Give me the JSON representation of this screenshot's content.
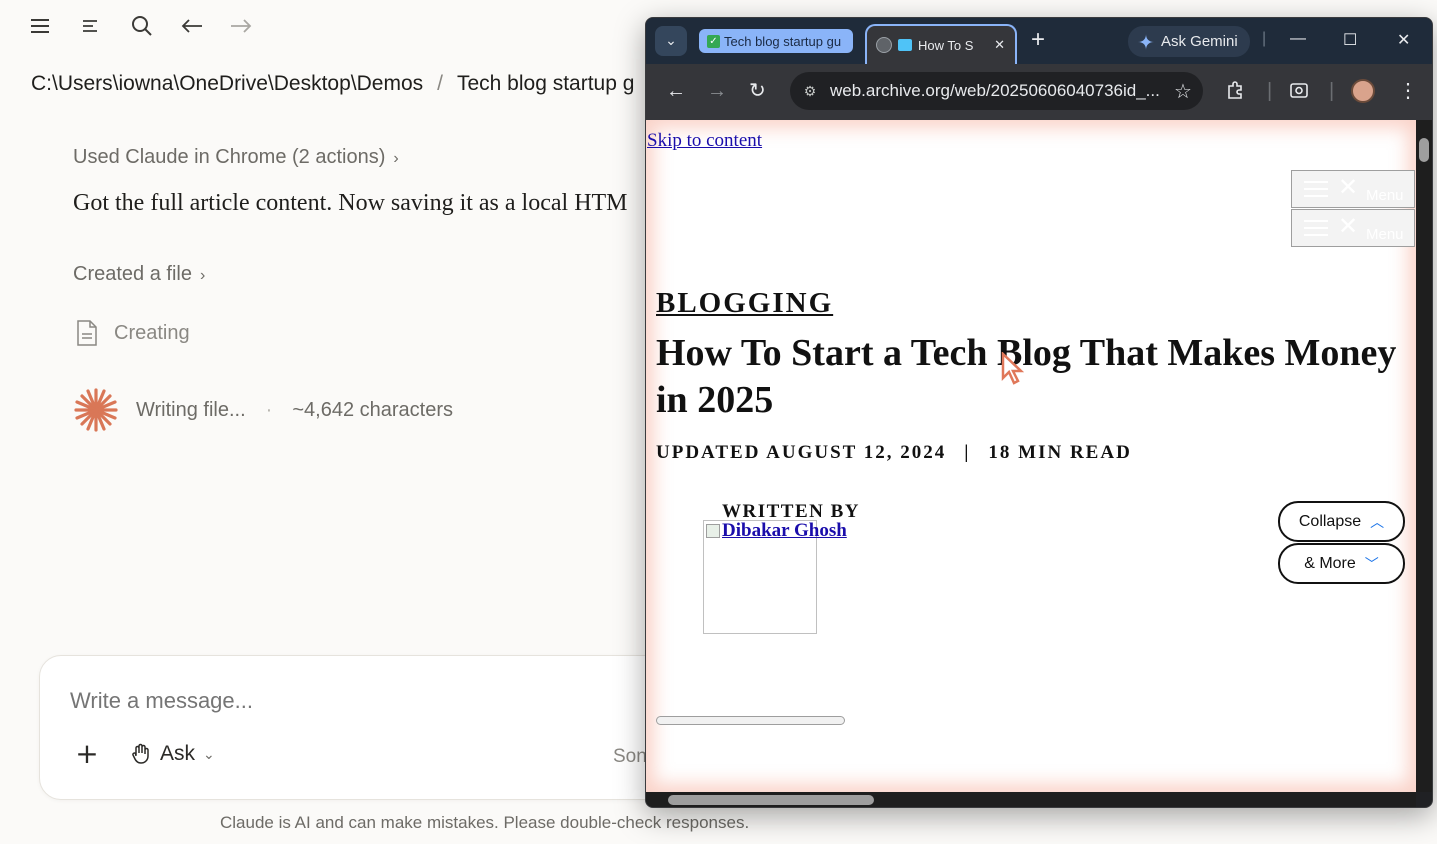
{
  "claude": {
    "breadcrumb": {
      "path": "C:\\Users\\iowna\\OneDrive\\Desktop\\Demos",
      "separator": "/",
      "project": "Tech blog startup g"
    },
    "chat": {
      "used_tool": "Used Claude in Chrome (2 actions)",
      "assistant_text": "Got the full article content. Now saving it as a local HTM",
      "created_file": "Created a file",
      "creating": "Creating",
      "writing_file": "Writing file...",
      "characters": "~4,642 characters"
    },
    "composer": {
      "placeholder": "Write a message...",
      "mode_label": "Ask",
      "model_peek": "Son"
    },
    "disclaimer": "Claude is AI and can make mistakes. Please double-check responses."
  },
  "chrome": {
    "tabs": [
      {
        "label": "Tech blog startup gu"
      },
      {
        "label": "How To S"
      }
    ],
    "ask_gemini": "Ask Gemini",
    "url": "web.archive.org/web/20250606040736id_..."
  },
  "page": {
    "skip_link": "Skip to content",
    "menu_label": "Menu",
    "category": "BLOGGING",
    "headline": "How To Start a Tech Blog That Makes Money in 2025",
    "updated": "UPDATED AUGUST 12, 2024",
    "meta_separator": "|",
    "read_time": "18 MIN READ",
    "written_by": "WRITTEN BY",
    "author": "Dibakar Ghosh",
    "collapse_label": "Collapse",
    "more_label": "& More"
  },
  "colors": {
    "claude_accent": "#d97757",
    "link": "#1a0dab",
    "chrome_frame": "#1f2b3a"
  }
}
